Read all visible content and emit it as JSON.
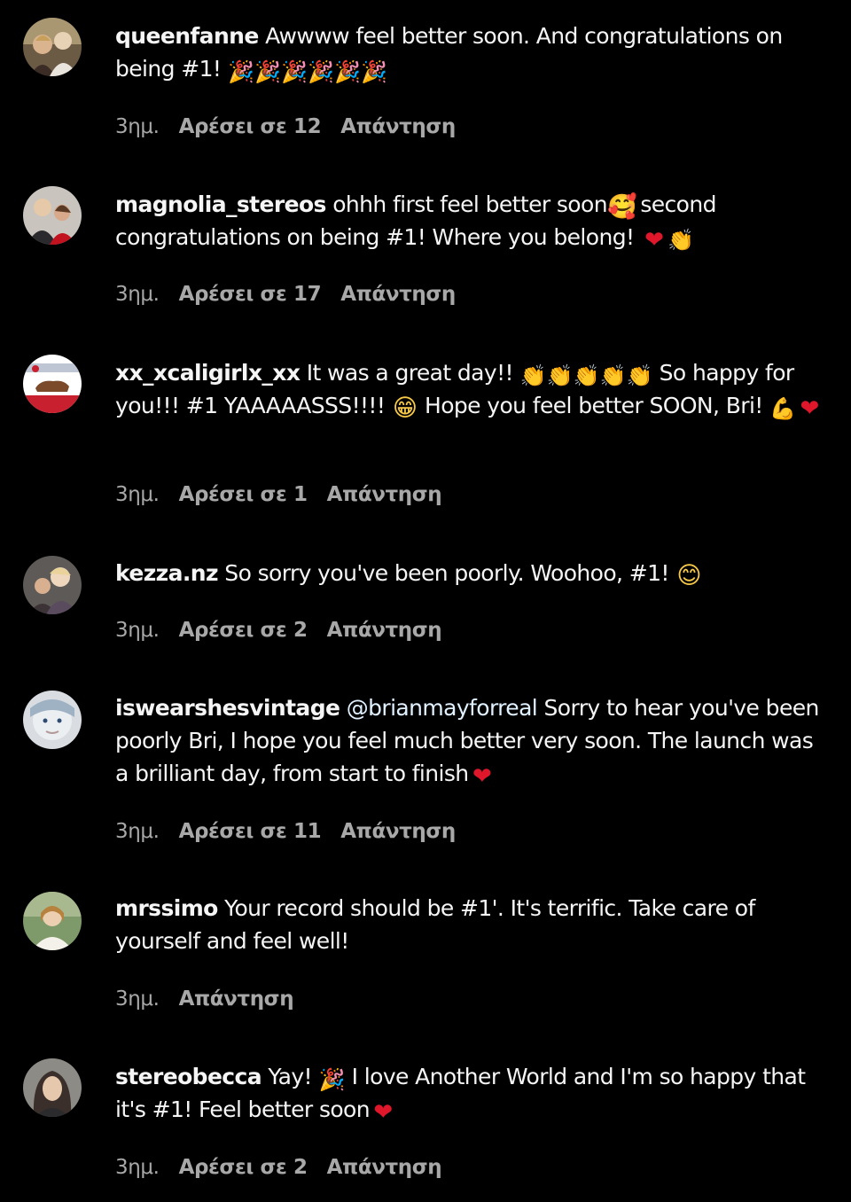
{
  "colors": {
    "background": "#000000",
    "text": "#f5f5f5",
    "meta": "#a8a8a8",
    "mention": "#e0f1ff",
    "heart": "#e0162b"
  },
  "emoji": {
    "party": "🎉",
    "heart": "❤",
    "clap": "👏",
    "smiling_hearts": "🥰",
    "grin": "😁",
    "muscle": "💪",
    "smile": "😊"
  },
  "comments": [
    {
      "username": "queenfanne",
      "text_a": "Awwww feel better soon. And congratulations on being #1!",
      "time": "3ημ.",
      "likes": "Αρέσει σε 12",
      "reply": "Απάντηση"
    },
    {
      "username": "magnolia_stereos",
      "text_a": "ohhh first feel better soon",
      "text_b": "second congratulations on being #1! Where you belong!",
      "time": "3ημ.",
      "likes": "Αρέσει σε 17",
      "reply": "Απάντηση"
    },
    {
      "username": "xx_xcaligirlx_xx",
      "text_a": "It was a great day!!",
      "text_b": "So happy for you!!! #1 YAAAAASSS!!!!",
      "text_c": "Hope you feel better SOON, Bri!",
      "time": "3ημ.",
      "likes": "Αρέσει σε 1",
      "reply": "Απάντηση"
    },
    {
      "username": "kezza.nz",
      "text_a": "So sorry you've been poorly. Woohoo, #1!",
      "time": "3ημ.",
      "likes": "Αρέσει σε 2",
      "reply": "Απάντηση"
    },
    {
      "username": "iswearshesvintage",
      "mention": "@brianmayforreal",
      "text_a": "Sorry to hear you've been poorly Bri, I hope you feel much better very soon. The launch was a brilliant day, from start to finish",
      "time": "3ημ.",
      "likes": "Αρέσει σε 11",
      "reply": "Απάντηση"
    },
    {
      "username": "mrssimo",
      "text_a": "Your record should be #1'. It's terrific. Take care of yourself and feel well!",
      "time": "3ημ.",
      "reply": "Απάντηση"
    },
    {
      "username": "stereobecca",
      "text_a": "Yay!",
      "text_b": "I love Another World and I'm so happy that it's #1! Feel better soon",
      "time": "3ημ.",
      "likes": "Αρέσει σε 2",
      "reply": "Απάντηση"
    }
  ]
}
